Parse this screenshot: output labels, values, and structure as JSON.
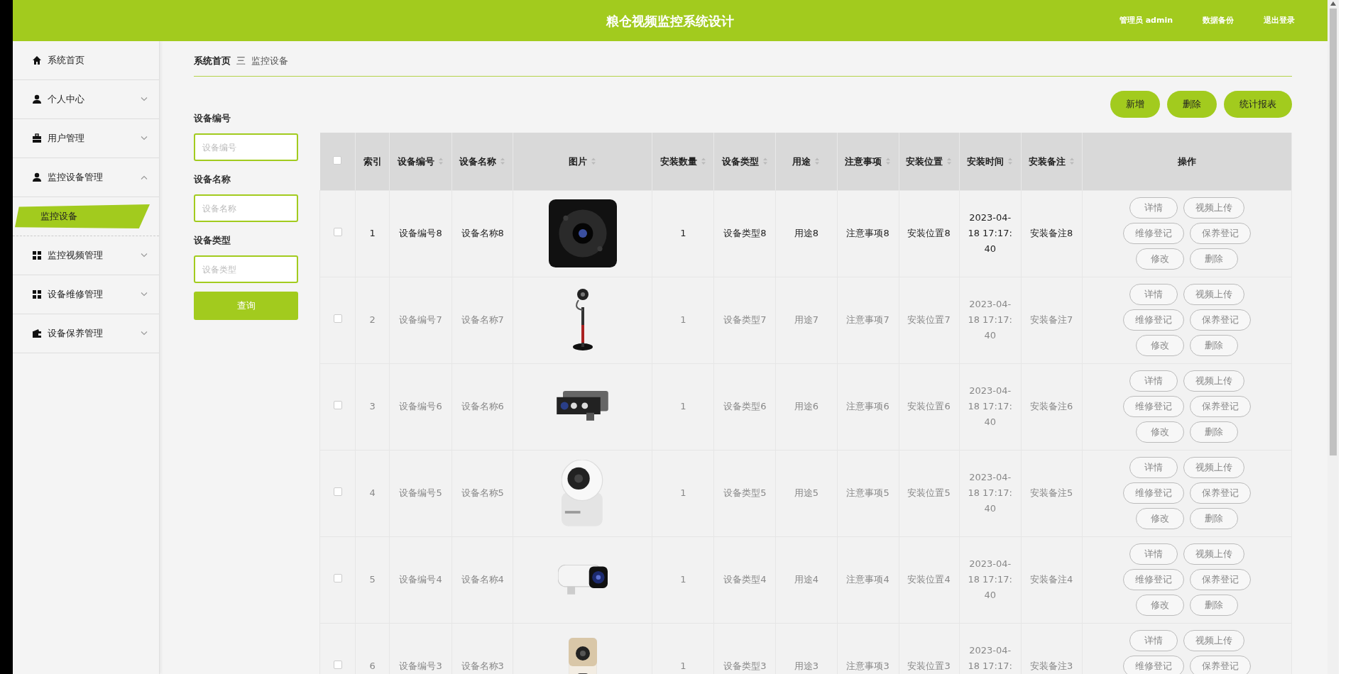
{
  "header": {
    "title": "粮仓视频监控系统设计",
    "links": [
      "管理员 admin",
      "数据备份",
      "退出登录"
    ]
  },
  "sidebar": {
    "items": [
      {
        "label": "系统首页",
        "kind": "link"
      },
      {
        "label": "个人中心",
        "kind": "group",
        "expanded": false
      },
      {
        "label": "用户管理",
        "kind": "group",
        "expanded": false
      },
      {
        "label": "监控设备管理",
        "kind": "group",
        "expanded": true,
        "children": [
          {
            "label": "监控设备",
            "selected": true
          }
        ]
      },
      {
        "label": "监控视频管理",
        "kind": "group",
        "expanded": false
      },
      {
        "label": "设备维修管理",
        "kind": "group",
        "expanded": false
      },
      {
        "label": "设备保养管理",
        "kind": "group",
        "expanded": false
      }
    ]
  },
  "breadcrumb": [
    "系统首页",
    "三",
    "监控设备"
  ],
  "search": {
    "fields": [
      {
        "label": "设备编号",
        "placeholder": "设备编号"
      },
      {
        "label": "设备名称",
        "placeholder": "设备名称"
      },
      {
        "label": "设备类型",
        "placeholder": "设备类型"
      }
    ],
    "button": "查询"
  },
  "toolbar": [
    "新增",
    "删除",
    "统计报表"
  ],
  "table": {
    "select_all": {
      "checked": false
    },
    "columns": [
      {
        "label": "索引",
        "kind": "text",
        "sortable": false
      },
      {
        "label": "设备编号",
        "kind": "text",
        "sortable": true
      },
      {
        "label": "设备名称",
        "kind": "text",
        "sortable": true
      },
      {
        "label": "图片",
        "kind": "picture",
        "sortable": true
      },
      {
        "label": "安装数量",
        "kind": "text",
        "sortable": true
      },
      {
        "label": "设备类型",
        "kind": "text",
        "sortable": true
      },
      {
        "label": "用途",
        "kind": "text",
        "sortable": true
      },
      {
        "label": "注意事项",
        "kind": "text",
        "sortable": true
      },
      {
        "label": "安装位置",
        "kind": "text",
        "sortable": true
      },
      {
        "label": "安装时间",
        "kind": "text",
        "sortable": true
      },
      {
        "label": "安装备注",
        "kind": "text",
        "sortable": true
      },
      {
        "label": "操作",
        "kind": "actions",
        "sortable": false
      }
    ],
    "rows": [
      {
        "checked": false,
        "highlighted": true,
        "cells": [
          "1",
          "设备编号8",
          "设备名称8",
          "",
          "1",
          "设备类型8",
          "用途8",
          "注意事项8",
          "安装位置8",
          "2023-04-18 17:17:40",
          "安装备注8"
        ],
        "actions": [
          "详情",
          "视频上传",
          "维修登记",
          "保养登记",
          "修改",
          "删除"
        ]
      },
      {
        "checked": false,
        "highlighted": false,
        "cells": [
          "2",
          "设备编号7",
          "设备名称7",
          "",
          "1",
          "设备类型7",
          "用途7",
          "注意事项7",
          "安装位置7",
          "2023-04-18 17:17:40",
          "安装备注7"
        ],
        "actions": [
          "详情",
          "视频上传",
          "维修登记",
          "保养登记",
          "修改",
          "删除"
        ]
      },
      {
        "checked": false,
        "highlighted": false,
        "cells": [
          "3",
          "设备编号6",
          "设备名称6",
          "",
          "1",
          "设备类型6",
          "用途6",
          "注意事项6",
          "安装位置6",
          "2023-04-18 17:17:40",
          "安装备注6"
        ],
        "actions": [
          "详情",
          "视频上传",
          "维修登记",
          "保养登记",
          "修改",
          "删除"
        ]
      },
      {
        "checked": false,
        "highlighted": false,
        "cells": [
          "4",
          "设备编号5",
          "设备名称5",
          "",
          "1",
          "设备类型5",
          "用途5",
          "注意事项5",
          "安装位置5",
          "2023-04-18 17:17:40",
          "安装备注5"
        ],
        "actions": [
          "详情",
          "视频上传",
          "维修登记",
          "保养登记",
          "修改",
          "删除"
        ]
      },
      {
        "checked": false,
        "highlighted": false,
        "cells": [
          "5",
          "设备编号4",
          "设备名称4",
          "",
          "1",
          "设备类型4",
          "用途4",
          "注意事项4",
          "安装位置4",
          "2023-04-18 17:17:40",
          "安装备注4"
        ],
        "actions": [
          "详情",
          "视频上传",
          "维修登记",
          "保养登记",
          "修改",
          "删除"
        ]
      },
      {
        "checked": false,
        "highlighted": false,
        "cells": [
          "6",
          "设备编号3",
          "设备名称3",
          "",
          "1",
          "设备类型3",
          "用途3",
          "注意事项3",
          "安装位置3",
          "2023-04-18 17:17:",
          "安装备注3"
        ],
        "actions": [
          "详情",
          "视频上传",
          "维修登记",
          "保养登记"
        ]
      }
    ]
  }
}
